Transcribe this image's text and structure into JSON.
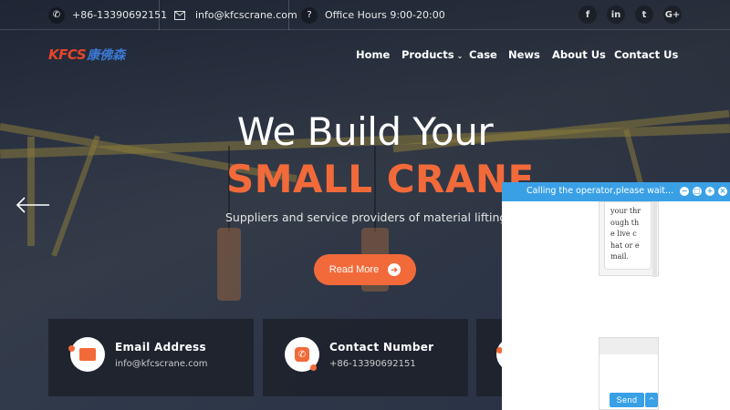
{
  "topbar": {
    "phone": "+86-13390692151",
    "email": "info@kfcscrane.com",
    "hours": "Office Hours 9:00-20:00",
    "social": [
      {
        "icon": "facebook-icon",
        "glyph": "f"
      },
      {
        "icon": "linkedin-icon",
        "glyph": "in"
      },
      {
        "icon": "twitter-icon",
        "glyph": "t"
      },
      {
        "icon": "google-plus-icon",
        "glyph": "G+"
      }
    ]
  },
  "logo": {
    "latin": "KFCS",
    "chinese": "康佛森"
  },
  "nav": {
    "home": "Home",
    "products": "Products",
    "case": "Case",
    "news": "News",
    "about": "About Us",
    "contact": "Contact Us"
  },
  "hero": {
    "line1": "We Build Your",
    "line2": "SMALL CRANE",
    "subtitle": "Suppliers and service providers of material lifting system",
    "cta": "Read More"
  },
  "cards": [
    {
      "title": "Email Address",
      "value": "info@kfcscrane.com",
      "icon": "envelope-icon"
    },
    {
      "title": "Contact Number",
      "value": "+86-13390692151",
      "icon": "phone-icon"
    }
  ],
  "chat": {
    "title": "Calling the operator,please wait...",
    "message_lines": [
      "your thr",
      "ough th",
      "e live c",
      "hat or e",
      "mail."
    ],
    "send_label": "Send",
    "more_label": "^"
  },
  "colors": {
    "accent": "#f26a3a",
    "chat_blue": "#3aa0e6",
    "logo_red": "#e8442a",
    "logo_blue": "#3a7ad6"
  }
}
